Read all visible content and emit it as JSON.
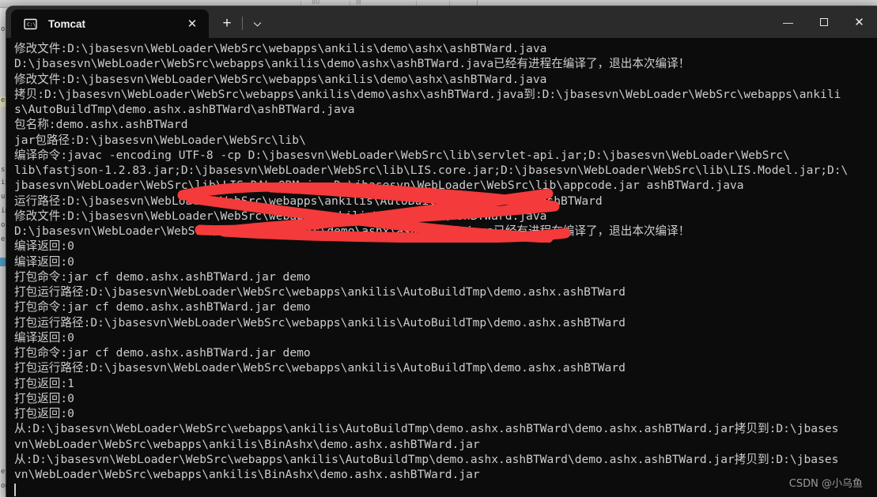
{
  "window": {
    "tab": {
      "title": "Tomcat",
      "icon": "command-prompt-icon",
      "close_label": "✕"
    },
    "new_tab_label": "+",
    "dropdown_icon": "chevron-down-icon",
    "controls": {
      "minimize_label": "—",
      "maximize_icon": "maximize-square-icon",
      "close_label": "✕"
    }
  },
  "background": {
    "toolbar_glyphs": [
      "80",
      "⊟",
      "|"
    ]
  },
  "terminal": {
    "foreground_color": "#cccccc",
    "background_color": "#0c0c0c",
    "lines": [
      "修改文件:D:\\jbasesvn\\WebLoader\\WebSrc\\webapps\\ankilis\\demo\\ashx\\ashBTWard.java",
      "D:\\jbasesvn\\WebLoader\\WebSrc\\webapps\\ankilis\\demo\\ashx\\ashBTWard.java已经有进程在编译了，退出本次编译！",
      "修改文件:D:\\jbasesvn\\WebLoader\\WebSrc\\webapps\\ankilis\\demo\\ashx\\ashBTWard.java",
      "拷贝:D:\\jbasesvn\\WebLoader\\WebSrc\\webapps\\ankilis\\demo\\ashx\\ashBTWard.java到:D:\\jbasesvn\\WebLoader\\WebSrc\\webapps\\ankili",
      "s\\AutoBuildTmp\\demo.ashx.ashBTWard\\ashBTWard.java",
      "包名称:demo.ashx.ashBTWard",
      "jar包路径:D:\\jbasesvn\\WebLoader\\WebSrc\\lib\\",
      "编译命令:javac -encoding UTF-8 -cp D:\\jbasesvn\\WebLoader\\WebSrc\\lib\\servlet-api.jar;D:\\jbasesvn\\WebLoader\\WebSrc\\",
      "lib\\fastjson-1.2.83.jar;D:\\jbasesvn\\WebLoader\\WebSrc\\lib\\LIS.core.jar;D:\\jbasesvn\\WebLoader\\WebSrc\\lib\\LIS.Model.jar;D:\\",
      "jbasesvn\\WebLoader\\WebSrc\\lib\\LIS.DAL.ORM.jar;D:\\jbasesvn\\WebLoader\\WebSrc\\lib\\appcode.jar ashBTWard.java",
      "运行路径:D:\\jbasesvn\\WebLoader\\WebSrc\\webapps\\ankilis\\AutoBuildTmp\\demo.ashx.ashBTWard",
      "修改文件:D:\\jbasesvn\\WebLoader\\WebSrc\\webapps\\ankilis\\demo\\ashx\\ashBTWard.java",
      "D:\\jbasesvn\\WebLoader\\WebSrc\\webapps\\ankilis\\demo\\ashx\\ashBTWard.java已经有进程在编译了，退出本次编译！",
      "编译返回:0",
      "编译返回:0",
      "打包命令:jar cf demo.ashx.ashBTWard.jar demo",
      "打包运行路径:D:\\jbasesvn\\WebLoader\\WebSrc\\webapps\\ankilis\\AutoBuildTmp\\demo.ashx.ashBTWard",
      "打包命令:jar cf demo.ashx.ashBTWard.jar demo",
      "打包运行路径:D:\\jbasesvn\\WebLoader\\WebSrc\\webapps\\ankilis\\AutoBuildTmp\\demo.ashx.ashBTWard",
      "编译返回:0",
      "打包命令:jar cf demo.ashx.ashBTWard.jar demo",
      "打包运行路径:D:\\jbasesvn\\WebLoader\\WebSrc\\webapps\\ankilis\\AutoBuildTmp\\demo.ashx.ashBTWard",
      "打包返回:1",
      "打包返回:0",
      "打包返回:0",
      "从:D:\\jbasesvn\\WebLoader\\WebSrc\\webapps\\ankilis\\AutoBuildTmp\\demo.ashx.ashBTWard\\demo.ashx.ashBTWard.jar拷贝到:D:\\jbases",
      "vn\\WebLoader\\WebSrc\\webapps\\ankilis\\BinAshx\\demo.ashx.ashBTWard.jar",
      "从:D:\\jbasesvn\\WebLoader\\WebSrc\\webapps\\ankilis\\AutoBuildTmp\\demo.ashx.ashBTWard\\demo.ashx.ashBTWard.jar拷贝到:D:\\jbases",
      "vn\\WebLoader\\WebSrc\\webapps\\ankilis\\BinAshx\\demo.ashx.ashBTWard.jar"
    ]
  },
  "annotation": {
    "color": "#f43a3a",
    "kind": "red-scribble-redaction"
  },
  "watermark": {
    "text": "CSDN @小乌鱼",
    "color": "#9b9b9b"
  }
}
